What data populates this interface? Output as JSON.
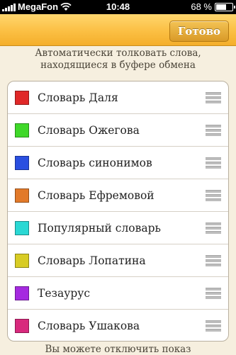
{
  "statusbar": {
    "carrier": "MegaFon",
    "time": "10:48",
    "battery": "68 %",
    "battery_level": 0.68
  },
  "navbar": {
    "done_label": "Готово"
  },
  "header": {
    "line1": "Автоматически толковать слова,",
    "line2": "находящиеся в буфере обмена"
  },
  "dictionaries": [
    {
      "label": "Словарь Даля",
      "color": "#e02828"
    },
    {
      "label": "Словарь Ожегова",
      "color": "#3fd829"
    },
    {
      "label": "Словарь синонимов",
      "color": "#2a4fe0"
    },
    {
      "label": "Словарь Ефремовой",
      "color": "#e27a2a"
    },
    {
      "label": "Популярный словарь",
      "color": "#2ad8d4"
    },
    {
      "label": "Словарь Лопатина",
      "color": "#d8cc24"
    },
    {
      "label": "Тезаурус",
      "color": "#a52ae0"
    },
    {
      "label": "Словарь Ушакова",
      "color": "#d8297d"
    }
  ],
  "footer": {
    "text": "Вы можете отключить показ"
  }
}
